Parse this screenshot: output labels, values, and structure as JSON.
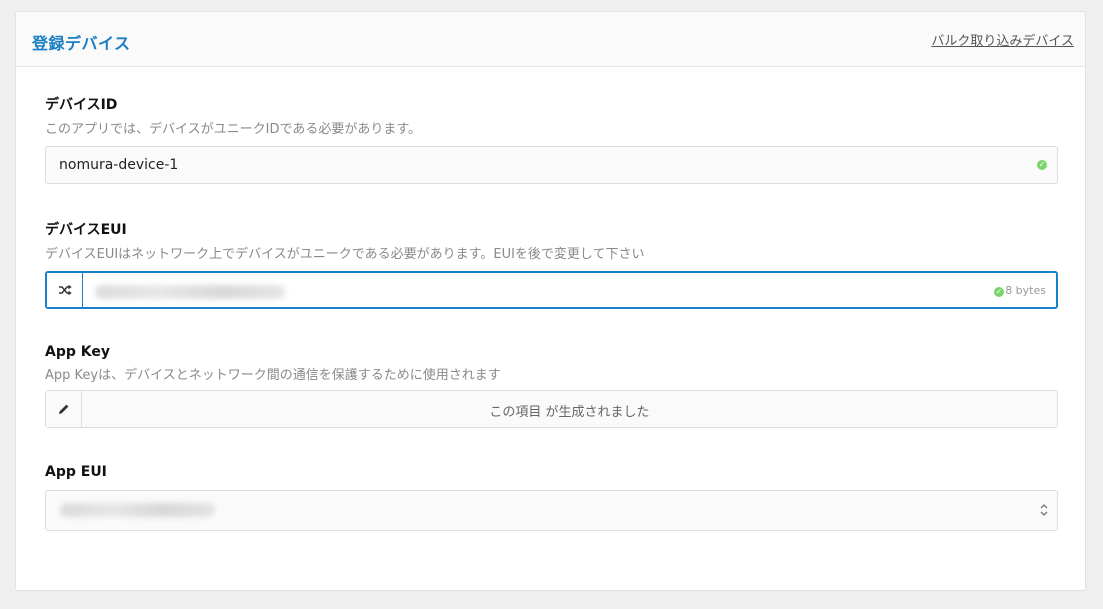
{
  "header": {
    "title": "登録デバイス",
    "bulk_link": "バルク取り込みデバイス"
  },
  "device_id": {
    "label": "デバイスID",
    "description": "このアプリでは、デバイスがユニークIDである必要があります。",
    "value": "nomura-device-1",
    "valid_icon": "check-circle-icon"
  },
  "device_eui": {
    "label": "デバイスEUI",
    "description": "デバイスEUIはネットワーク上でデバイスがユニークである必要があります。EUIを後で変更して下さい",
    "addon_icon": "shuffle-icon",
    "value_blurred": true,
    "bytes_label": "8 bytes",
    "valid_icon": "check-circle-icon"
  },
  "app_key": {
    "label": "App Key",
    "description": "App Keyは、デバイスとネットワーク間の通信を保護するために使用されます",
    "addon_icon": "pencil-icon",
    "generated_text": "この項目 が生成されました"
  },
  "app_eui": {
    "label": "App EUI",
    "value_blurred": true,
    "select_icon": "chevron-up-down-icon"
  },
  "colors": {
    "accent": "#1a7ec2",
    "valid": "#7bd36b",
    "active_border": "#1a80c9"
  }
}
